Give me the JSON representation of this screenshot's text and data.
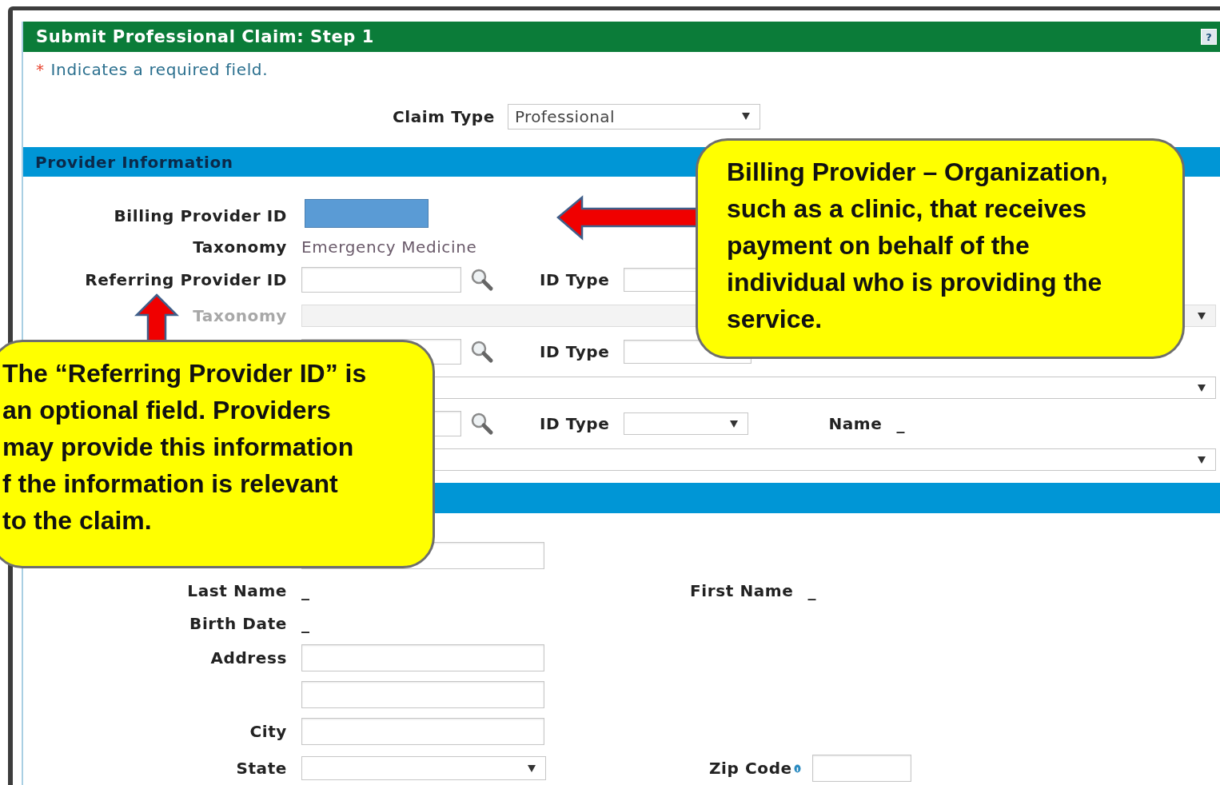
{
  "panel": {
    "title": "Submit Professional Claim: Step 1",
    "help": "?"
  },
  "required_note": {
    "marker": "*",
    "text": "Indicates a required field."
  },
  "claim_type": {
    "label": "Claim Type",
    "value": "Professional"
  },
  "provider_section": {
    "title": "Provider Information"
  },
  "provider_rows": [
    {
      "kind": "redacted",
      "label": "Billing Provider ID"
    },
    {
      "kind": "text",
      "label": "Taxonomy",
      "value": "Emergency Medicine"
    },
    {
      "kind": "lookup",
      "label": "Referring Provider ID",
      "id_type_label": "ID Type"
    },
    {
      "kind": "select",
      "label": "Taxonomy",
      "disabled": true
    },
    {
      "kind": "lookup",
      "id_type_label": "ID Type"
    },
    {
      "kind": "select"
    },
    {
      "kind": "lookup_name",
      "id_type_label": "ID Type",
      "name_label": "Name",
      "name_value": "_"
    },
    {
      "kind": "select"
    }
  ],
  "patient_rows": [
    {
      "kind": "input"
    },
    {
      "kind": "pair",
      "label": "Last Name",
      "value": "_",
      "label_2": "First Name",
      "value_2": "_"
    },
    {
      "kind": "value",
      "label": "Birth Date",
      "value": "_"
    },
    {
      "kind": "input",
      "label": "Address"
    },
    {
      "kind": "input"
    },
    {
      "kind": "input",
      "label": "City"
    },
    {
      "kind": "state_zip",
      "label": "State",
      "label_2": "Zip Code"
    }
  ],
  "callouts": [
    {
      "kind": "arrow_left",
      "lines": [
        "Billing Provider – Organization,",
        "such as a clinic, that receives",
        "payment on behalf of the",
        "individual who is providing the",
        "service."
      ]
    },
    {
      "kind": "arrow_up",
      "lines": [
        "The “Referring Provider ID” is",
        "an optional field. Providers",
        "may provide this information",
        "f the information is relevant",
        "to the claim."
      ]
    }
  ]
}
